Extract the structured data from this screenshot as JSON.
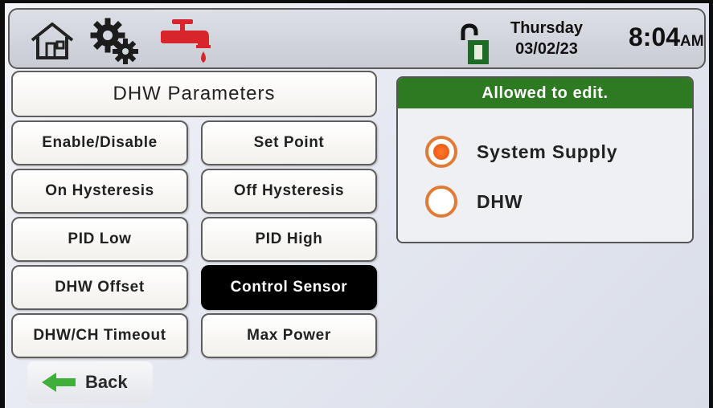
{
  "header": {
    "day": "Thursday",
    "date": "03/02/23",
    "time": "8:04",
    "ampm": "AM",
    "icons": [
      "home-icon",
      "gear-icon",
      "faucet-icon",
      "unlock-icon"
    ],
    "lock_badge": "I"
  },
  "page_title": "DHW Parameters",
  "menu": {
    "enable_disable": "Enable/Disable",
    "set_point": "Set Point",
    "on_hysteresis": "On Hysteresis",
    "off_hysteresis": "Off Hysteresis",
    "pid_low": "PID Low",
    "pid_high": "PID High",
    "dhw_offset": "DHW Offset",
    "control_sensor": "Control Sensor",
    "dhw_ch_timeout": "DHW/CH Timeout",
    "max_power": "Max Power",
    "selected": "Control Sensor"
  },
  "panel": {
    "header": "Allowed to edit.",
    "options": [
      "System Supply",
      "DHW"
    ],
    "selected_option": "System Supply"
  },
  "back_label": "Back",
  "colors": {
    "panel_header": "#2e7a22",
    "radio_accent": "#e07a35",
    "faucet": "#d8242b",
    "back_arrow": "#3fae3a"
  }
}
